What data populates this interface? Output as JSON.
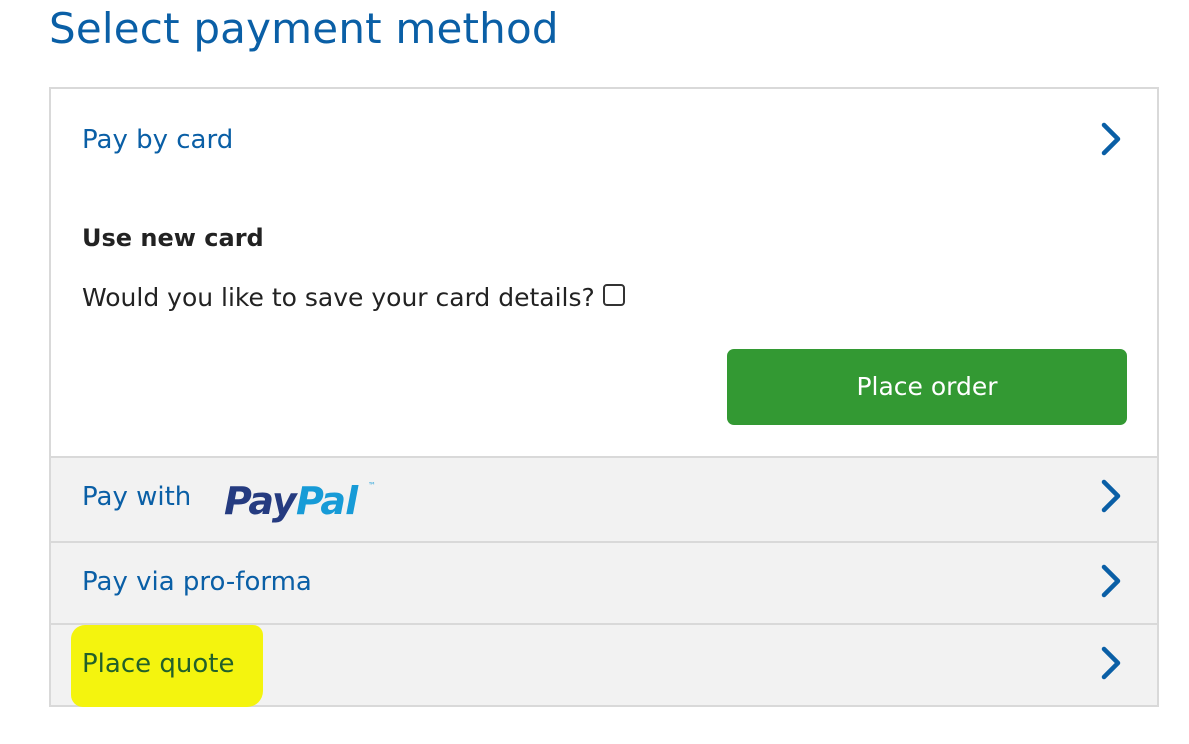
{
  "page": {
    "title": "Select payment method"
  },
  "methods": {
    "card": {
      "label": "Pay by card",
      "subtitle": "Use new card",
      "save_label": "Would you like to save your card details?",
      "save_checked": false,
      "place_order_label": "Place order"
    },
    "paypal": {
      "label": "Pay with",
      "logo_text": "PayPal",
      "logo_trademark": "™"
    },
    "proforma": {
      "label": "Pay via pro-forma"
    },
    "quote": {
      "label": "Place quote",
      "highlighted": true
    }
  },
  "colors": {
    "link_blue": "#0a5fa6",
    "place_order_green": "#339933",
    "highlight_yellow": "#f4f40e",
    "paypal_dark": "#253b80",
    "paypal_light": "#179bd7"
  },
  "icons": {
    "chevron": "chevron-right-icon"
  }
}
